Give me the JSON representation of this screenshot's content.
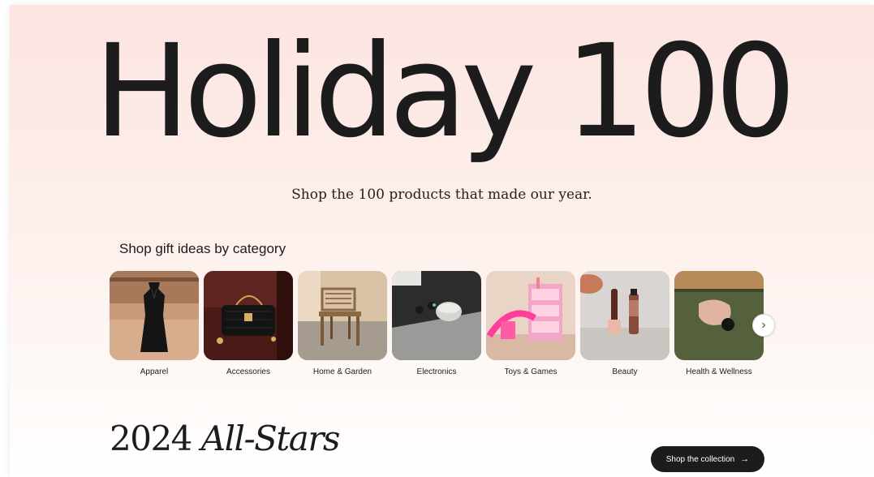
{
  "hero": {
    "title": "Holiday 100",
    "subtitle": "Shop the 100 products that made our year."
  },
  "categories_section": {
    "heading": "Shop gift ideas by category",
    "items": [
      {
        "label": "Apparel",
        "icon": "dress-photo"
      },
      {
        "label": "Accessories",
        "icon": "handbag-photo"
      },
      {
        "label": "Home & Garden",
        "icon": "chair-photo"
      },
      {
        "label": "Electronics",
        "icon": "earbuds-photo"
      },
      {
        "label": "Toys & Games",
        "icon": "dollhouse-photo"
      },
      {
        "label": "Beauty",
        "icon": "lip-gloss-photo"
      },
      {
        "label": "Health & Wellness",
        "icon": "massager-photo"
      }
    ],
    "next_icon": "chevron-right-icon"
  },
  "allstars": {
    "year": "2024",
    "title_italic": "All-Stars",
    "cta_label": "Shop the collection",
    "cta_icon": "arrow-right-icon"
  },
  "colors": {
    "accent": "#1c1c1c",
    "background_top": "#fce4e1"
  }
}
